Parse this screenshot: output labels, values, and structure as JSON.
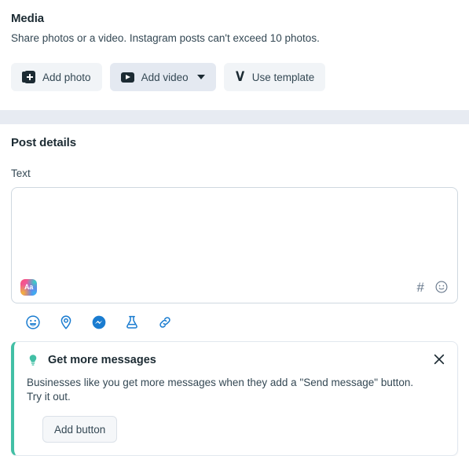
{
  "media": {
    "title": "Media",
    "description": "Share photos or a video. Instagram posts can't exceed 10 photos.",
    "buttons": [
      {
        "label": "Add photo",
        "icon": "photo-stack-icon"
      },
      {
        "label": "Add video",
        "icon": "video-play-icon",
        "caret": "chevron-down-icon"
      },
      {
        "label": "Use template",
        "icon": "template-v-icon"
      }
    ]
  },
  "post_details": {
    "title": "Post details",
    "text_label": "Text",
    "composer": {
      "value": "",
      "placeholder": "",
      "font_style_icon": "aa-text-style-icon",
      "font_style_label": "Aa",
      "hashtag_icon": "hashtag-icon",
      "hashtag_glyph": "#",
      "emoji_icon": "emoji-smiley-icon"
    },
    "tool_icons": [
      "feeling-activity-icon",
      "location-pin-icon",
      "messenger-icon",
      "flask-experiment-icon",
      "link-icon"
    ]
  },
  "tip": {
    "icon": "lightbulb-icon",
    "title": "Get more messages",
    "body": "Businesses like you get more messages when they add a \"Send message\" button. Try it out.",
    "action_label": "Add button",
    "close_icon": "close-icon"
  },
  "colors": {
    "accent_teal": "#42bfa5",
    "icon_blue": "#1a7cd0",
    "band": "#e7ebf2",
    "text_primary": "#1c2b33",
    "text_secondary": "#344854"
  }
}
